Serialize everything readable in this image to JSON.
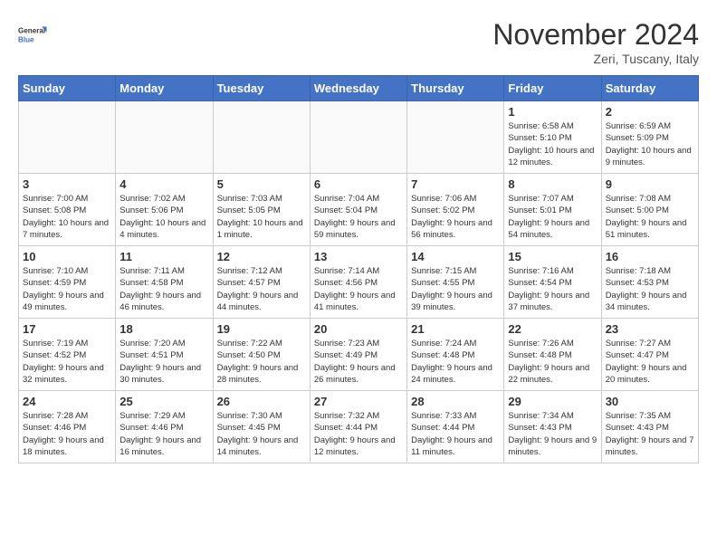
{
  "header": {
    "logo_line1": "General",
    "logo_line2": "Blue",
    "month_title": "November 2024",
    "location": "Zeri, Tuscany, Italy"
  },
  "days_of_week": [
    "Sunday",
    "Monday",
    "Tuesday",
    "Wednesday",
    "Thursday",
    "Friday",
    "Saturday"
  ],
  "weeks": [
    [
      {
        "day": "",
        "info": ""
      },
      {
        "day": "",
        "info": ""
      },
      {
        "day": "",
        "info": ""
      },
      {
        "day": "",
        "info": ""
      },
      {
        "day": "",
        "info": ""
      },
      {
        "day": "1",
        "info": "Sunrise: 6:58 AM\nSunset: 5:10 PM\nDaylight: 10 hours and 12 minutes."
      },
      {
        "day": "2",
        "info": "Sunrise: 6:59 AM\nSunset: 5:09 PM\nDaylight: 10 hours and 9 minutes."
      }
    ],
    [
      {
        "day": "3",
        "info": "Sunrise: 7:00 AM\nSunset: 5:08 PM\nDaylight: 10 hours and 7 minutes."
      },
      {
        "day": "4",
        "info": "Sunrise: 7:02 AM\nSunset: 5:06 PM\nDaylight: 10 hours and 4 minutes."
      },
      {
        "day": "5",
        "info": "Sunrise: 7:03 AM\nSunset: 5:05 PM\nDaylight: 10 hours and 1 minute."
      },
      {
        "day": "6",
        "info": "Sunrise: 7:04 AM\nSunset: 5:04 PM\nDaylight: 9 hours and 59 minutes."
      },
      {
        "day": "7",
        "info": "Sunrise: 7:06 AM\nSunset: 5:02 PM\nDaylight: 9 hours and 56 minutes."
      },
      {
        "day": "8",
        "info": "Sunrise: 7:07 AM\nSunset: 5:01 PM\nDaylight: 9 hours and 54 minutes."
      },
      {
        "day": "9",
        "info": "Sunrise: 7:08 AM\nSunset: 5:00 PM\nDaylight: 9 hours and 51 minutes."
      }
    ],
    [
      {
        "day": "10",
        "info": "Sunrise: 7:10 AM\nSunset: 4:59 PM\nDaylight: 9 hours and 49 minutes."
      },
      {
        "day": "11",
        "info": "Sunrise: 7:11 AM\nSunset: 4:58 PM\nDaylight: 9 hours and 46 minutes."
      },
      {
        "day": "12",
        "info": "Sunrise: 7:12 AM\nSunset: 4:57 PM\nDaylight: 9 hours and 44 minutes."
      },
      {
        "day": "13",
        "info": "Sunrise: 7:14 AM\nSunset: 4:56 PM\nDaylight: 9 hours and 41 minutes."
      },
      {
        "day": "14",
        "info": "Sunrise: 7:15 AM\nSunset: 4:55 PM\nDaylight: 9 hours and 39 minutes."
      },
      {
        "day": "15",
        "info": "Sunrise: 7:16 AM\nSunset: 4:54 PM\nDaylight: 9 hours and 37 minutes."
      },
      {
        "day": "16",
        "info": "Sunrise: 7:18 AM\nSunset: 4:53 PM\nDaylight: 9 hours and 34 minutes."
      }
    ],
    [
      {
        "day": "17",
        "info": "Sunrise: 7:19 AM\nSunset: 4:52 PM\nDaylight: 9 hours and 32 minutes."
      },
      {
        "day": "18",
        "info": "Sunrise: 7:20 AM\nSunset: 4:51 PM\nDaylight: 9 hours and 30 minutes."
      },
      {
        "day": "19",
        "info": "Sunrise: 7:22 AM\nSunset: 4:50 PM\nDaylight: 9 hours and 28 minutes."
      },
      {
        "day": "20",
        "info": "Sunrise: 7:23 AM\nSunset: 4:49 PM\nDaylight: 9 hours and 26 minutes."
      },
      {
        "day": "21",
        "info": "Sunrise: 7:24 AM\nSunset: 4:48 PM\nDaylight: 9 hours and 24 minutes."
      },
      {
        "day": "22",
        "info": "Sunrise: 7:26 AM\nSunset: 4:48 PM\nDaylight: 9 hours and 22 minutes."
      },
      {
        "day": "23",
        "info": "Sunrise: 7:27 AM\nSunset: 4:47 PM\nDaylight: 9 hours and 20 minutes."
      }
    ],
    [
      {
        "day": "24",
        "info": "Sunrise: 7:28 AM\nSunset: 4:46 PM\nDaylight: 9 hours and 18 minutes."
      },
      {
        "day": "25",
        "info": "Sunrise: 7:29 AM\nSunset: 4:46 PM\nDaylight: 9 hours and 16 minutes."
      },
      {
        "day": "26",
        "info": "Sunrise: 7:30 AM\nSunset: 4:45 PM\nDaylight: 9 hours and 14 minutes."
      },
      {
        "day": "27",
        "info": "Sunrise: 7:32 AM\nSunset: 4:44 PM\nDaylight: 9 hours and 12 minutes."
      },
      {
        "day": "28",
        "info": "Sunrise: 7:33 AM\nSunset: 4:44 PM\nDaylight: 9 hours and 11 minutes."
      },
      {
        "day": "29",
        "info": "Sunrise: 7:34 AM\nSunset: 4:43 PM\nDaylight: 9 hours and 9 minutes."
      },
      {
        "day": "30",
        "info": "Sunrise: 7:35 AM\nSunset: 4:43 PM\nDaylight: 9 hours and 7 minutes."
      }
    ]
  ]
}
